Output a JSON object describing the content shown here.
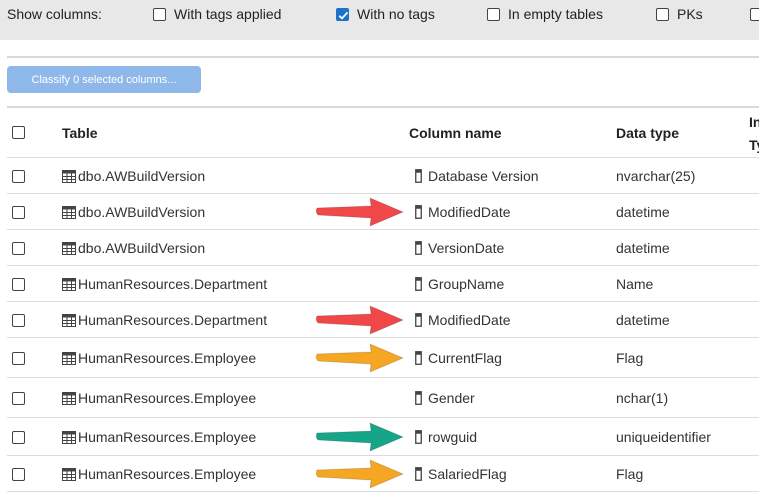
{
  "filter_bar": {
    "label": "Show columns:",
    "options": [
      {
        "label": "With tags applied",
        "checked": false
      },
      {
        "label": "With no tags",
        "checked": true
      },
      {
        "label": "In empty tables",
        "checked": false
      },
      {
        "label": "PKs",
        "checked": false
      },
      {
        "label": "",
        "checked": false
      }
    ]
  },
  "toolbar": {
    "classify_label": "Classify 0 selected columns..."
  },
  "table": {
    "headers": {
      "table": "Table",
      "column_name": "Column name",
      "data_type": "Data type",
      "extra_line1": "In",
      "extra_line2": "Ty"
    },
    "rows": [
      {
        "table": "dbo.AWBuildVersion",
        "column": "Database Version",
        "data_type": "nvarchar(25)",
        "arrow": null
      },
      {
        "table": "dbo.AWBuildVersion",
        "column": "ModifiedDate",
        "data_type": "datetime",
        "arrow": "red"
      },
      {
        "table": "dbo.AWBuildVersion",
        "column": "VersionDate",
        "data_type": "datetime",
        "arrow": null
      },
      {
        "table": "HumanResources.Department",
        "column": "GroupName",
        "data_type": "Name",
        "arrow": null
      },
      {
        "table": "HumanResources.Department",
        "column": "ModifiedDate",
        "data_type": "datetime",
        "arrow": "red"
      },
      {
        "table": "HumanResources.Employee",
        "column": "CurrentFlag",
        "data_type": "Flag",
        "arrow": "orange"
      },
      {
        "table": "HumanResources.Employee",
        "column": "Gender",
        "data_type": "nchar(1)",
        "arrow": null
      },
      {
        "table": "HumanResources.Employee",
        "column": "rowguid",
        "data_type": "uniqueidentifier",
        "arrow": "teal"
      },
      {
        "table": "HumanResources.Employee",
        "column": "SalariedFlag",
        "data_type": "Flag",
        "arrow": "orange"
      }
    ]
  },
  "colors": {
    "accent": "#1a73c8",
    "button_disabled": "#8fb8ea",
    "arrow_red": "#f04848",
    "arrow_orange": "#f5a623",
    "arrow_teal": "#17a589"
  },
  "icons": {
    "cursor": "mouse-pointer-icon",
    "table": "table-grid-icon",
    "column": "column-icon",
    "arrow": "arrow-right-icon"
  }
}
